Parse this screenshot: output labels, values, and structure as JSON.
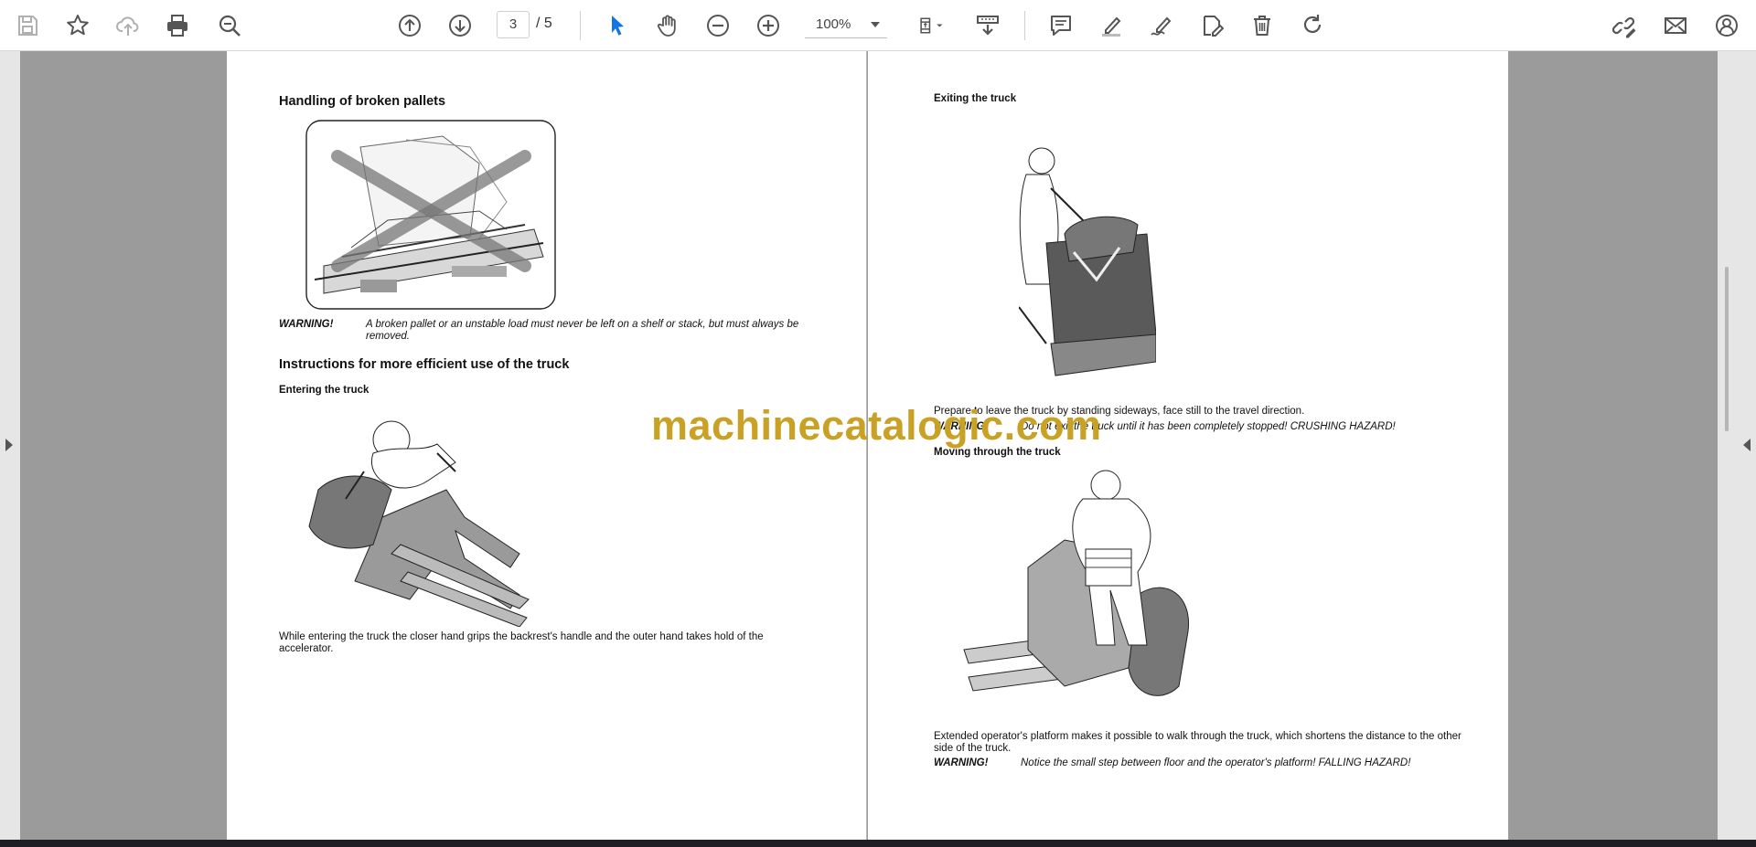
{
  "toolbar": {
    "current_page": "3",
    "page_total": "/ 5",
    "zoom": "100%",
    "accent_color": "#1473e6"
  },
  "left_page": {
    "section1_title": "Handling of broken pallets",
    "warning1_label": "WARNING!",
    "warning1_line1": "A broken pallet or an unstable load must never be left on a shelf or stack, but must always be",
    "warning1_line2": "removed.",
    "section2_title": "Instructions for more efficient use of the truck",
    "entering_title": "Entering the truck",
    "entering_line1": "While entering the truck the closer hand grips the backrest's handle and the outer hand takes hold of the",
    "entering_line2": "accelerator."
  },
  "right_page": {
    "exiting_title": "Exiting the truck",
    "exiting_text": "Prepare to leave the truck by standing sideways, face still to the travel direction.",
    "warning2_label": "WARNING!",
    "warning2_text": "Do not exit the truck until it has been completely stopped! CRUSHING HAZARD!",
    "moving_title": "Moving through the truck",
    "moving_line1": "Extended operator's platform makes it possible to walk through the truck, which shortens the distance to the other",
    "moving_line2": "side of the truck.",
    "warning3_label": "WARNING!",
    "warning3_text": "Notice the small step between floor and the operator's platform! FALLING HAZARD!"
  },
  "watermark": "machinecatalogic.com"
}
